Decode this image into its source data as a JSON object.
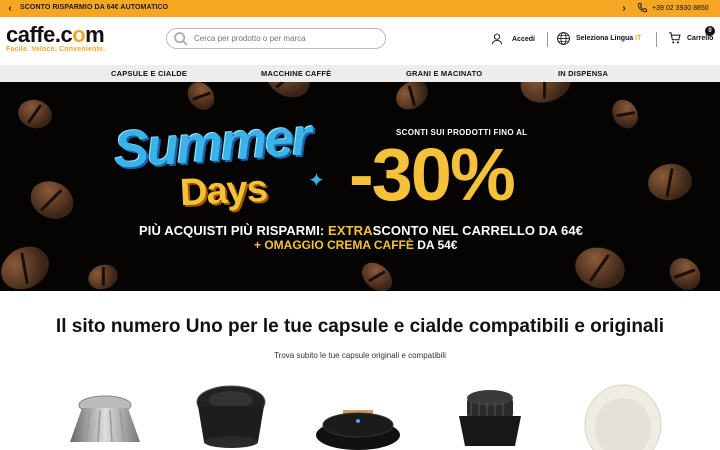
{
  "promo": {
    "message": "SCONTO RISPARMIO DA 64€ AUTOMATICO",
    "phone": "+39 02 3930 8850",
    "prev_icon": "chevron-left-icon",
    "next_icon": "chevron-right-icon"
  },
  "header": {
    "brand_left": "caffe.c",
    "brand_o": "o",
    "brand_right": "m",
    "tagline": "Facile. Veloce. Conveniente.",
    "search_placeholder": "Cerca per prodotto o per marca",
    "login": "Accedi",
    "language_label": "Seleziona Lingua",
    "language_code": "IT",
    "cart_label": "Carrello",
    "cart_count": "0"
  },
  "nav": {
    "items": [
      "CAPSULE E CIALDE",
      "MACCHINE CAFFÈ",
      "GRANI E MACINATO",
      "IN DISPENSA"
    ]
  },
  "hero": {
    "summer": "Summer",
    "days": "Days",
    "sconti": "SCONTI SUI PRODOTTI FINO AL",
    "percent": "-30%",
    "line1_a": "PIÙ ACQUISTI PIÙ RISPARMI: ",
    "line1_b": "EXTRA",
    "line1_c": "SCONTO NEL CARRELLO DA 64€",
    "line2_a": "+ OMAGGIO CREMA CAFFÈ ",
    "line2_b": "DA 54€"
  },
  "content": {
    "headline": "Il sito numero Uno per le tue capsule e cialde compatibili e originali",
    "subline": "Trova subito le tue capsule originali e compatibili"
  },
  "colors": {
    "accent": "#f5a623",
    "hero_bg": "#050403",
    "summer_blue": "#3ab3e8",
    "hero_yellow": "#f6c13a"
  }
}
